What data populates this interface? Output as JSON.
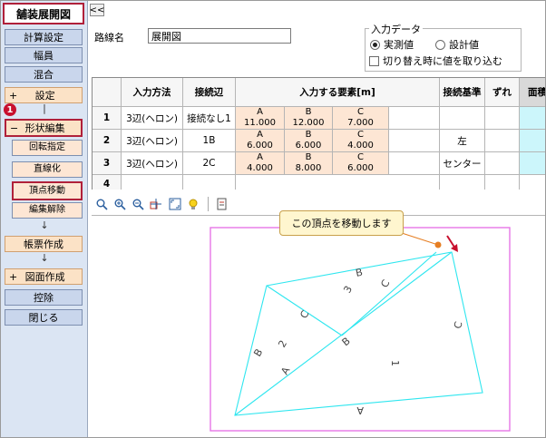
{
  "sidebar": {
    "title": "舗装展開図",
    "items": [
      {
        "label": "計算設定"
      },
      {
        "label": "幅員"
      },
      {
        "label": "混合"
      },
      {
        "prefix": "+",
        "label": "設定"
      },
      {
        "prefix": "−",
        "label": "形状編集"
      },
      {
        "label": "回転指定"
      },
      {
        "label": "直線化"
      },
      {
        "label": "頂点移動"
      },
      {
        "label": "編集解除"
      },
      {
        "label": "帳票作成"
      },
      {
        "prefix": "+",
        "label": "図面作成"
      },
      {
        "label": "控除"
      },
      {
        "label": "閉じる"
      }
    ],
    "arrow": "↓",
    "badge": "1"
  },
  "collapse_label": "<<",
  "route": {
    "label": "路線名",
    "value": "展開図"
  },
  "input_data": {
    "legend": "入力データ",
    "options": [
      "実測値",
      "設計値"
    ],
    "selected": "実測値",
    "checkbox_label": "切り替え時に値を取り込む"
  },
  "table": {
    "headers": [
      "入力方法",
      "接続辺",
      "入力する要素[m]",
      "接続基準",
      "ずれ",
      "面積"
    ],
    "rows": [
      {
        "num": "1",
        "method": "3辺(ヘロン)",
        "edge": "接続なし1",
        "elements": [
          {
            "k": "A",
            "v": "11.000"
          },
          {
            "k": "B",
            "v": "12.000"
          },
          {
            "k": "C",
            "v": "7.000"
          }
        ],
        "basis": ""
      },
      {
        "num": "2",
        "method": "3辺(ヘロン)",
        "edge": "1B",
        "elements": [
          {
            "k": "A",
            "v": "6.000"
          },
          {
            "k": "B",
            "v": "6.000"
          },
          {
            "k": "C",
            "v": "4.000"
          }
        ],
        "basis": "左"
      },
      {
        "num": "3",
        "method": "3辺(ヘロン)",
        "edge": "2C",
        "elements": [
          {
            "k": "A",
            "v": "4.000"
          },
          {
            "k": "B",
            "v": "8.000"
          },
          {
            "k": "C",
            "v": "6.000"
          }
        ],
        "basis": "センター"
      },
      {
        "num": "4",
        "method": "",
        "edge": "",
        "elements": [],
        "basis": ""
      }
    ]
  },
  "toolbar": {
    "icons": [
      "zoom-icon",
      "zoom-in-icon",
      "zoom-out-icon",
      "pan-icon",
      "fit-icon",
      "light-icon",
      "print-icon"
    ]
  },
  "callout": "この頂点を移動します",
  "drawing_labels": {
    "t1": [
      "A",
      "1",
      "C"
    ],
    "t2": [
      "A",
      "2",
      "B",
      "C"
    ],
    "t3": [
      "B",
      "3",
      "C"
    ],
    "shared_b": "B"
  },
  "colors": {
    "sidebar_bg": "#dbe5f3",
    "button_blue": "#c9d6ec",
    "button_gold": "#fbe2c6",
    "highlight": "#b0203a",
    "shape": "#2ee6ef",
    "frame": "#e676e6",
    "vertex": "#e67e22"
  }
}
